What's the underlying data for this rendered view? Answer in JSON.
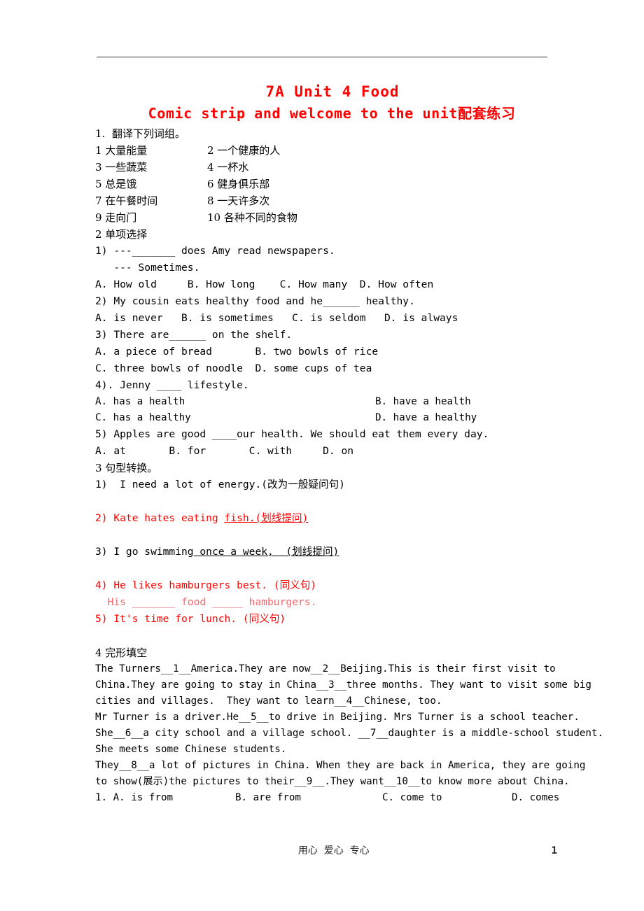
{
  "document": {
    "title_line1": "7A Unit 4   Food",
    "title_line2": "Comic strip and welcome to the unit配套练习",
    "title_color": "#ff0000",
    "page_number": "1",
    "footer_motto": "用心  爱心  专心"
  },
  "section1": {
    "heading": "1.  翻译下列词组。",
    "pairs": [
      {
        "left": "1 大量能量",
        "right": "2 一个健康的人"
      },
      {
        "left": "3 一些蔬菜",
        "right": "4 一杯水"
      },
      {
        "left": "5 总是饿",
        "right": "6 健身俱乐部"
      },
      {
        "left": "7 在午餐时间",
        "right": "8 一天许多次"
      },
      {
        "left": "9 走向门",
        "right": "10 各种不同的食物"
      }
    ]
  },
  "section2": {
    "heading": "2 单项选择",
    "questions": [
      {
        "stem": "1) ---_______ does Amy read newspapers.",
        "stem2": "   --- Sometimes.",
        "options": "A. How old     B. How long    C. How many  D. How often"
      },
      {
        "stem": "2) My cousin eats healthy food and he______ healthy.",
        "options": "A. is never   B. is sometimes   C. is seldom   D. is always"
      },
      {
        "stem": "3) There are______ on the shelf.",
        "options_a": "A. a piece of bread       B. two bowls of rice",
        "options_b": "C. three bowls of noodle  D. some cups of tea"
      },
      {
        "stem": "4). Jenny ____ lifestyle.",
        "opt_left_1": "A. has a health",
        "opt_right_1": "B. have a health",
        "opt_left_2": "C. has a healthy",
        "opt_right_2": "D. have a healthy"
      },
      {
        "stem": "5) Apples are good ____our health. We should eat them every day.",
        "options": "A. at       B. for       C. with     D. on"
      }
    ]
  },
  "section3": {
    "heading": "3 句型转换。",
    "items": [
      {
        "text": "1)  I need a lot of energy.(改为一般疑问句)",
        "color": "black"
      },
      {
        "text": "2) Kate hates eating ",
        "underlined": "fish.(划线提问)",
        "color": "red"
      },
      {
        "text": "3) I go swimming",
        "underlined": " once a week,  (划线提问)",
        "color": "black"
      },
      {
        "text": "4) He likes hamburgers best. (同义句)",
        "color": "red"
      },
      {
        "text": "  His _______ food _____ hamburgers.",
        "color": "softred"
      },
      {
        "text": "5) It's time for lunch. (同义句)",
        "color": "red"
      }
    ]
  },
  "section4": {
    "heading": "4 完形填空",
    "paragraphs": [
      [
        "The Turners__1__America.They are now__2__Beijing.This is their first visit to",
        "China.They are going to stay in China__3__three months. They want to visit some big",
        "cities and villages.  They want to learn__4__Chinese, too."
      ],
      [
        "Mr Turner is a driver.He__5__to drive in Beijing. Mrs Turner is a school teacher.",
        "She__6__a city school and a village school. __7__daughter is a middle-school student.",
        "She meets some Chinese students."
      ],
      [
        "They__8__a lot of pictures in China. When they are back in America, they are going",
        "to show(展示)the pictures to their__9__.They want__10__to know more about China."
      ]
    ],
    "answer_rows": [
      {
        "number": "1.",
        "a": "A. is from",
        "b": "B. are from",
        "c": "C. come to",
        "d": "D. comes"
      }
    ]
  }
}
